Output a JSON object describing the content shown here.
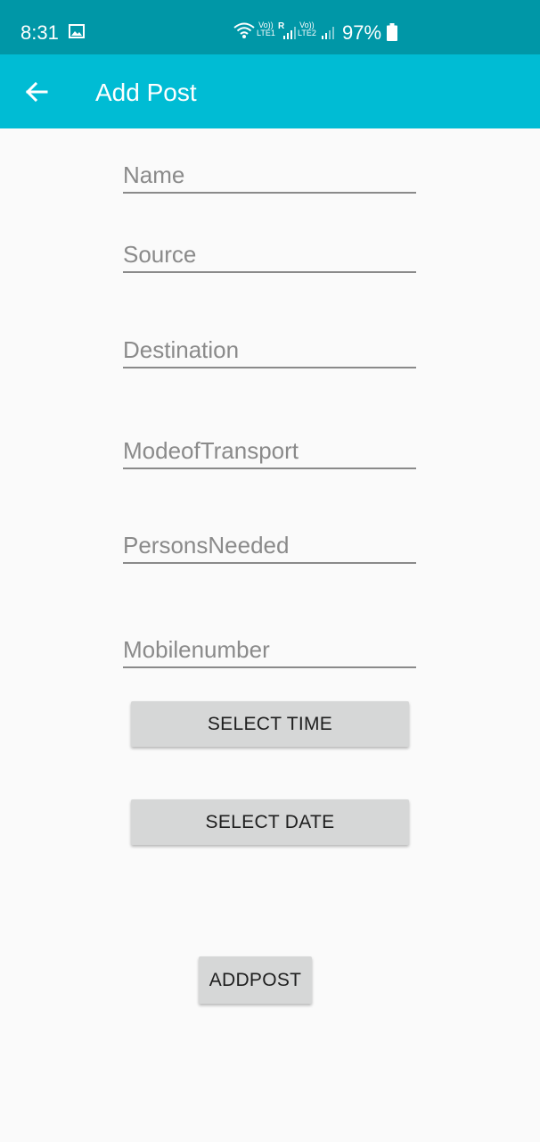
{
  "status_bar": {
    "time": "8:31",
    "sim1_top": "Vo))",
    "sim1_bottom": "LTE1",
    "roaming": "R",
    "sim2_top": "Vo))",
    "sim2_bottom": "LTE2",
    "battery": "97%",
    "icons": [
      "gallery-icon",
      "wifi-icon",
      "signal-icon",
      "battery-icon"
    ],
    "color": "#0097a7"
  },
  "app_bar": {
    "title": "Add Post",
    "back_icon": "arrow-left-icon",
    "color": "#00bcd4"
  },
  "form": {
    "name_placeholder": "Name",
    "source_placeholder": "Source",
    "destination_placeholder": "Destination",
    "transport_placeholder": "ModeofTransport",
    "persons_placeholder": "PersonsNeeded",
    "mobile_placeholder": "Mobilenumber"
  },
  "buttons": {
    "select_time": "SELECT TIME",
    "select_date": "SELECT DATE",
    "add_post": "ADDPOST"
  }
}
